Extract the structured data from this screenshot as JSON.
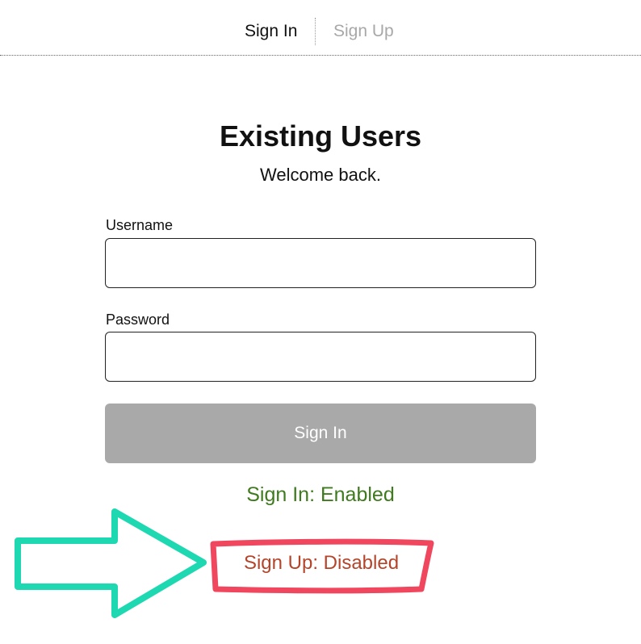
{
  "tabs": {
    "sign_in": "Sign In",
    "sign_up": "Sign Up"
  },
  "form": {
    "heading": "Existing Users",
    "subheading": "Welcome back.",
    "username_label": "Username",
    "username_value": "",
    "password_label": "Password",
    "password_value": "",
    "submit_label": "Sign In"
  },
  "status": {
    "sign_in": "Sign In: Enabled",
    "sign_up": "Sign Up: Disabled"
  },
  "annotation": {
    "arrow_color": "#1ed8b2",
    "highlight_color": "#f0465e"
  },
  "colors": {
    "enabled": "#3f7a1e",
    "disabled": "#b4452a",
    "button": "#a9a9a9"
  }
}
